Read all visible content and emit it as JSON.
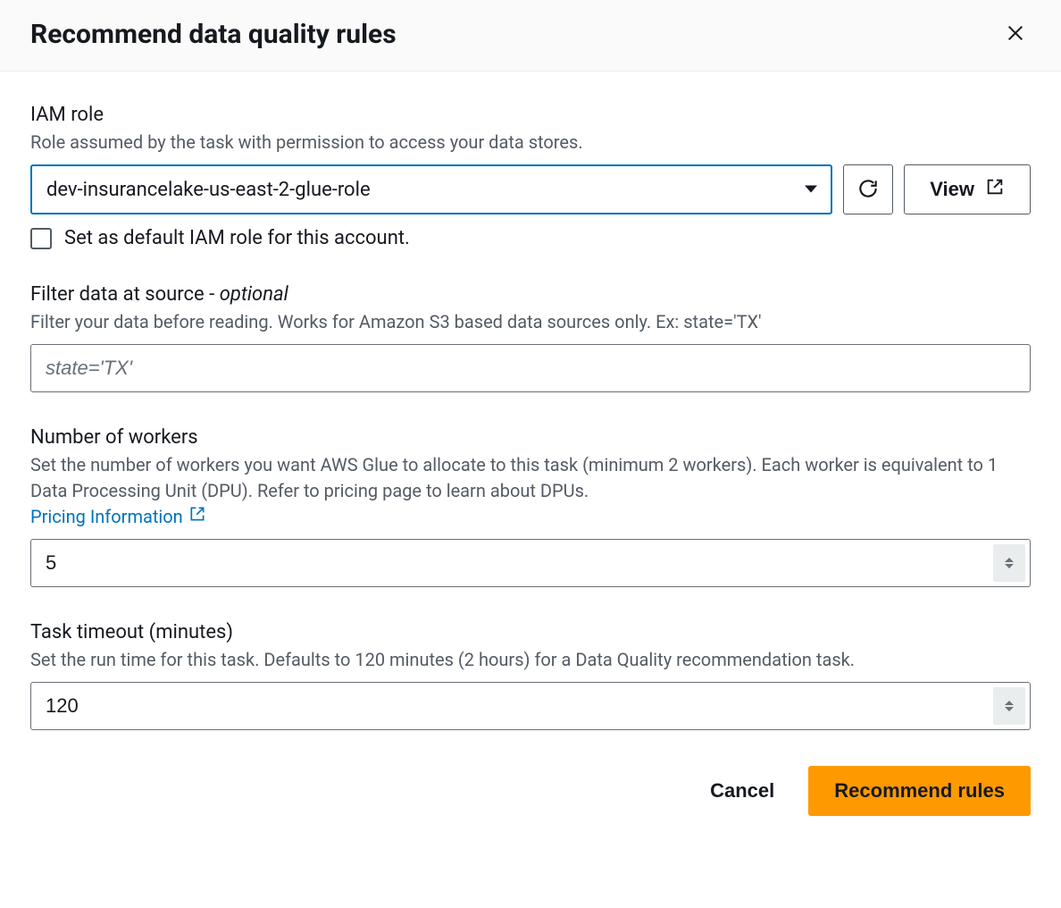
{
  "header": {
    "title": "Recommend data quality rules"
  },
  "iam_role": {
    "label": "IAM role",
    "help": "Role assumed by the task with permission to access your data stores.",
    "value": "dev-insurancelake-us-east-2-glue-role",
    "view_label": "View",
    "checkbox_label": "Set as default IAM role for this account."
  },
  "filter": {
    "label_main": "Filter data at source - ",
    "label_optional": "optional",
    "help": "Filter your data before reading. Works for Amazon S3 based data sources only. Ex: state='TX'",
    "placeholder": "state='TX'"
  },
  "workers": {
    "label": "Number of workers",
    "help": "Set the number of workers you want AWS Glue to allocate to this task (minimum 2 workers). Each worker is equivalent to 1 Data Processing Unit (DPU). Refer to pricing page to learn about DPUs.",
    "link_text": "Pricing Information",
    "value": "5"
  },
  "timeout": {
    "label": "Task timeout (minutes)",
    "help": "Set the run time for this task. Defaults to 120 minutes (2 hours) for a Data Quality recommendation task.",
    "value": "120"
  },
  "footer": {
    "cancel": "Cancel",
    "primary": "Recommend rules"
  }
}
